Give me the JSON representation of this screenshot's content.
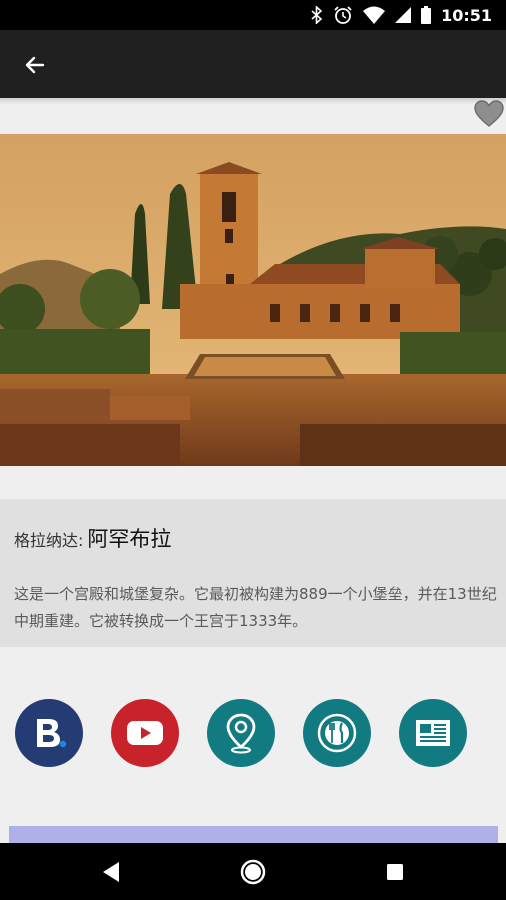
{
  "status_bar": {
    "time": "10:51",
    "icons": [
      "bluetooth-icon",
      "alarm-icon",
      "wifi-icon",
      "signal-icon",
      "battery-icon"
    ]
  },
  "toolbar": {
    "back_icon": "arrow-left-icon"
  },
  "favorite": {
    "icon": "heart-icon",
    "color": "#8e8e8e"
  },
  "place": {
    "city_prefix": "格拉纳达:",
    "name": "阿罕布拉",
    "description": "这是一个宫殿和城堡复杂。它最初被构建为889一个小堡垒，并在13世纪中期重建。它被转换成一个王宫于1333年。"
  },
  "actions": [
    {
      "id": "booking",
      "icon": "booking-icon",
      "color": "#253b73"
    },
    {
      "id": "youtube",
      "icon": "youtube-play-icon",
      "color": "#c8222b"
    },
    {
      "id": "map",
      "icon": "map-pin-icon",
      "color": "#127b82"
    },
    {
      "id": "food",
      "icon": "plate-cutlery-icon",
      "color": "#127b82"
    },
    {
      "id": "news",
      "icon": "newspaper-icon",
      "color": "#127b82"
    }
  ],
  "nav_bar": {
    "icons": [
      "back-triangle-icon",
      "home-circle-icon",
      "recents-square-icon"
    ]
  }
}
